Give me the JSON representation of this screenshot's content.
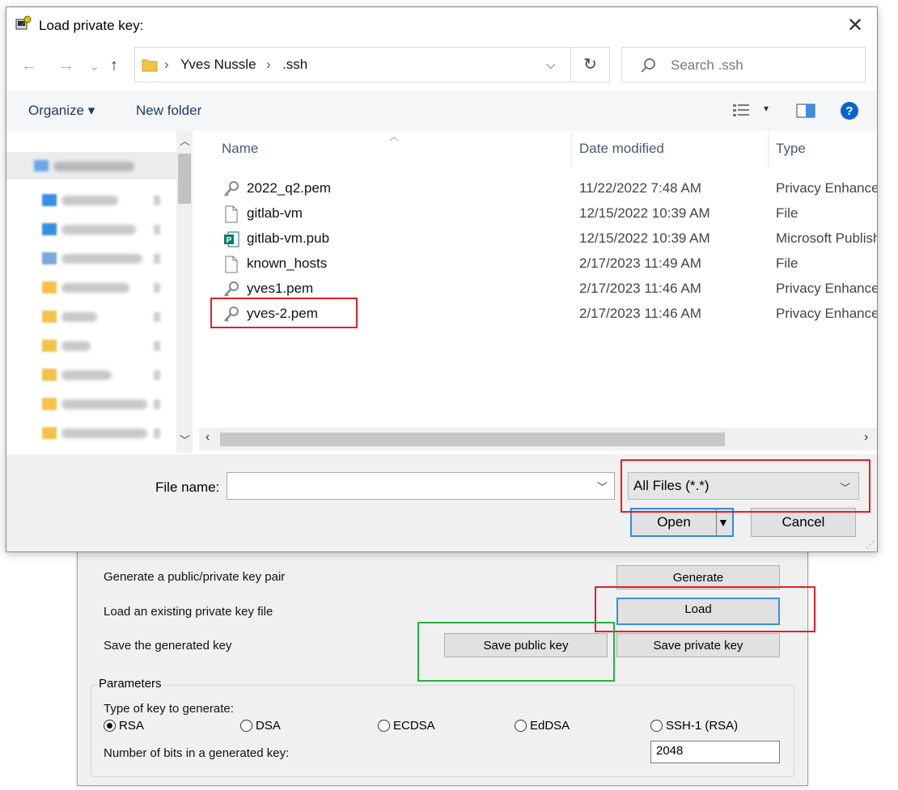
{
  "dialog": {
    "title": "Load private key:",
    "nav": {
      "back": "←",
      "forward": "→",
      "recent": "⌄",
      "up": "↑"
    },
    "breadcrumb": [
      "Yves Nussle",
      ".ssh"
    ],
    "search_placeholder": "Search .ssh",
    "commands": {
      "organize": "Organize ▾",
      "new_folder": "New folder"
    },
    "columns": {
      "name": "Name",
      "date": "Date modified",
      "type": "Type"
    },
    "files": [
      {
        "name": "2022_q2.pem",
        "date": "11/22/2022 7:48 AM",
        "type": "Privacy Enhanced Mail",
        "icon": "key-file-icon"
      },
      {
        "name": "gitlab-vm",
        "date": "12/15/2022 10:39 AM",
        "type": "File",
        "icon": "blank-file-icon"
      },
      {
        "name": "gitlab-vm.pub",
        "date": "12/15/2022 10:39 AM",
        "type": "Microsoft Publisher Document",
        "icon": "publisher-file-icon"
      },
      {
        "name": "known_hosts",
        "date": "2/17/2023 11:49 AM",
        "type": "File",
        "icon": "blank-file-icon"
      },
      {
        "name": "yves1.pem",
        "date": "2/17/2023 11:46 AM",
        "type": "Privacy Enhanced Mail",
        "icon": "key-file-icon"
      },
      {
        "name": "yves-2.pem",
        "date": "2/17/2023 11:46 AM",
        "type": "Privacy Enhanced Mail",
        "icon": "key-file-icon"
      }
    ],
    "file_name_label": "File name:",
    "file_name_value": "",
    "filter_selected": "All Files (*.*)",
    "open_label": "Open",
    "cancel_label": "Cancel"
  },
  "puttygen": {
    "actions": {
      "generate_desc": "Generate a public/private key pair",
      "generate_label": "Generate",
      "load_desc": "Load an existing private key file",
      "load_label": "Load",
      "save_desc": "Save the generated key",
      "save_public_label": "Save public key",
      "save_private_label": "Save private key"
    },
    "parameters": {
      "legend": "Parameters",
      "type_label": "Type of key to generate:",
      "types": [
        "RSA",
        "DSA",
        "ECDSA",
        "EdDSA",
        "SSH-1 (RSA)"
      ],
      "selected_type": "RSA",
      "bits_label": "Number of bits in a generated key:",
      "bits_value": "2048"
    }
  },
  "colors": {
    "highlight_red": "#e0202a",
    "highlight_blue": "#2f8be6",
    "highlight_green": "#23b23a",
    "help_blue": "#0a64c8"
  }
}
